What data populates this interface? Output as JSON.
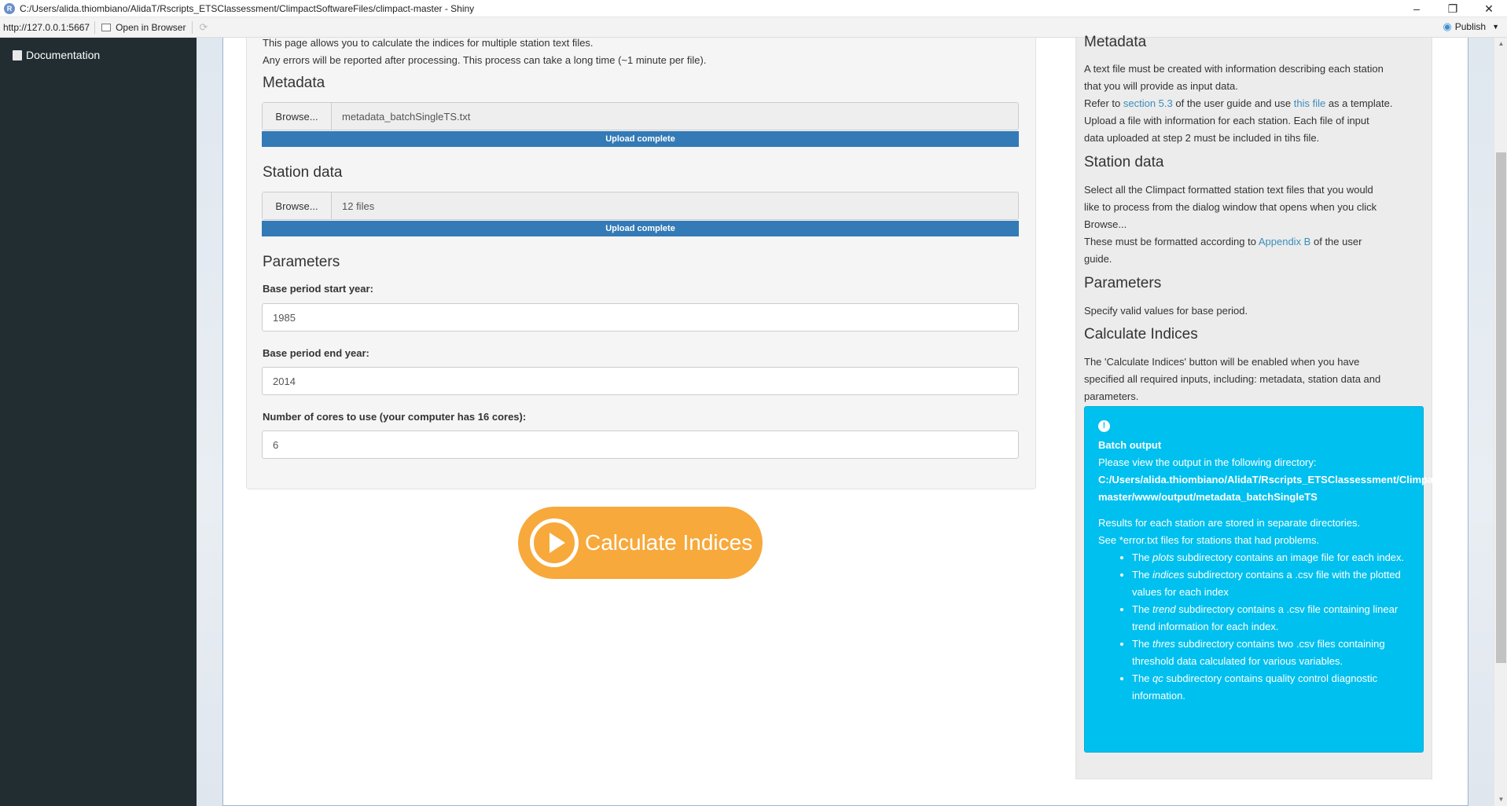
{
  "window": {
    "title": "C:/Users/alida.thiombiano/AlidaT/Rscripts_ETSClassessment/ClimpactSoftwareFiles/climpact-master - Shiny",
    "minimize": "–",
    "restore": "❐",
    "close": "✕"
  },
  "addressbar": {
    "url": "http://127.0.0.1:5667",
    "open_in_browser": "Open in Browser",
    "publish": "Publish"
  },
  "sidebar": {
    "items": [
      {
        "label": "Documentation"
      }
    ]
  },
  "main": {
    "intro_line1": "This page allows you to calculate the indices for multiple station text files.",
    "intro_line2": "Any errors will be reported after processing. This process can take a long time (~1 minute per file).",
    "metadata": {
      "heading": "Metadata",
      "browse": "Browse...",
      "file": "metadata_batchSingleTS.txt",
      "progress": "Upload complete",
      "progress_value": 1.0
    },
    "station": {
      "heading": "Station data",
      "browse": "Browse...",
      "file": "12 files",
      "progress": "Upload complete",
      "progress_value": 1.0
    },
    "parameters": {
      "heading": "Parameters",
      "start_label": "Base period start year:",
      "start_value": "1985",
      "end_label": "Base period end year:",
      "end_value": "2014",
      "cores_label": "Number of cores to use (your computer has 16 cores):",
      "cores_value": "6"
    },
    "calculate_button": "Calculate Indices"
  },
  "help": {
    "metadata_heading": "Metadata",
    "metadata_p1": "A text file must be created with information describing each station",
    "metadata_p2": "that you will provide as input data.",
    "metadata_refer": "Refer to",
    "metadata_link1": "section 5.3",
    "metadata_mid": "of the user guide and use",
    "metadata_link2": "this file",
    "metadata_end": "as a template.",
    "metadata_p4": "Upload a file with information for each station. Each file of input",
    "metadata_p5": "data uploaded at step 2 must be included in tihs file.",
    "station_heading": "Station data",
    "station_p1": "Select all the Climpact formatted station text files that you would",
    "station_p2": "like to process from the dialog window that opens when you click",
    "station_p3": "Browse...",
    "station_p4a": "These must be formatted according to",
    "station_link": "Appendix B",
    "station_p4b": "of the user",
    "station_p5": "guide.",
    "params_heading": "Parameters",
    "params_p": "Specify valid values for base period.",
    "calc_heading": "Calculate Indices",
    "calc_p1": "The 'Calculate Indices' button will be enabled when you have",
    "calc_p2": "specified all required inputs, including: metadata, station data and",
    "calc_p3": "parameters.",
    "alert": {
      "icon": "!",
      "title": "Batch output",
      "line1": "Please view the output in the following directory:",
      "path1": "C:/Users/alida.thiombiano/AlidaT/Rscripts_ETSClassessment/ClimpactSoft",
      "path2": "master/www/output/metadata_batchSingleTS",
      "line2": "Results for each station are stored in separate directories.",
      "line3": "See *error.txt files for stations that had problems.",
      "items": [
        {
          "pre": "The ",
          "em": "plots",
          "post": " subdirectory contains an image file for each index."
        },
        {
          "pre": "The ",
          "em": "indices",
          "post": " subdirectory contains a .csv file with the plotted values for each index"
        },
        {
          "pre": "The ",
          "em": "trend",
          "post": " subdirectory contains a .csv file containing linear trend information for each index."
        },
        {
          "pre": "The ",
          "em": "thres",
          "post": " subdirectory contains two .csv files containing threshold data calculated for various variables."
        },
        {
          "pre": "The ",
          "em": "qc",
          "post": " subdirectory contains quality control diagnostic information."
        }
      ]
    }
  }
}
